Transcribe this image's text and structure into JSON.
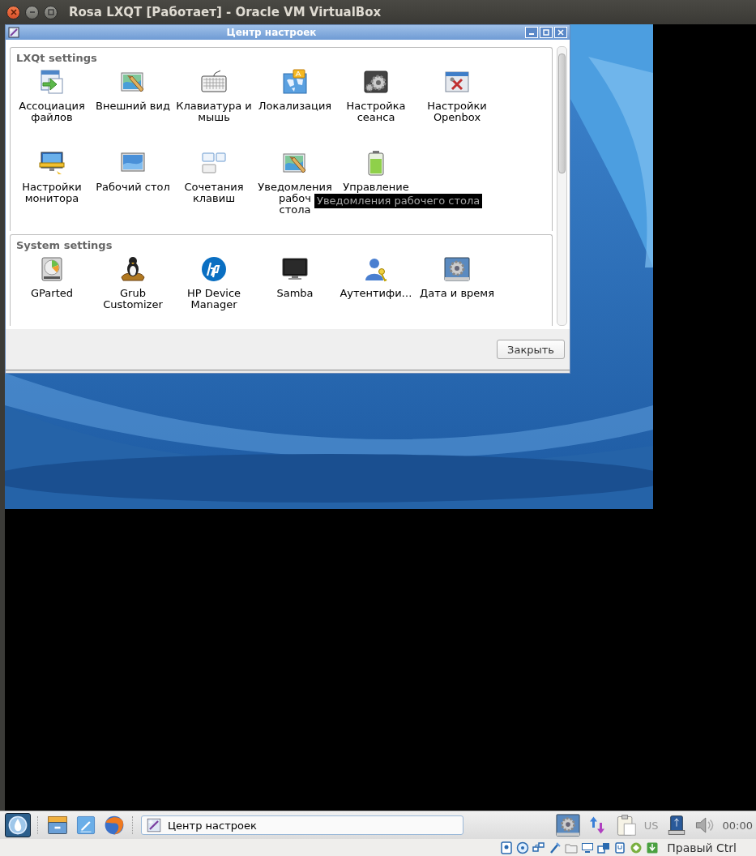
{
  "host_window": {
    "title": "Rosa LXQT [Работает] - Oracle VM VirtualBox"
  },
  "dialog": {
    "title": "Центр настроек",
    "groups": [
      {
        "title": "LXQt settings",
        "items": [
          {
            "label": "Ассоциация\nфайлов"
          },
          {
            "label": "Внешний вид"
          },
          {
            "label": "Клавиатура и\nмышь"
          },
          {
            "label": "Локализация"
          },
          {
            "label": "Настройка\nсеанса"
          },
          {
            "label": "Настройки\nOpenbox"
          },
          {
            "label": "Настройки\nмонитора"
          },
          {
            "label": "Рабочий стол"
          },
          {
            "label": "Сочетания\nклавиш"
          },
          {
            "label": "Уведомления\nрабоч\nстола"
          },
          {
            "label": "Управление"
          }
        ]
      },
      {
        "title": "System settings",
        "items": [
          {
            "label": "GParted"
          },
          {
            "label": "Grub\nCustomizer"
          },
          {
            "label": "HP Device\nManager"
          },
          {
            "label": "Samba"
          },
          {
            "label": "Аутентифи…"
          },
          {
            "label": "Дата и время"
          }
        ]
      }
    ],
    "tooltip": "Уведомления рабочего стола",
    "buttons": [
      "Закрыть"
    ]
  },
  "taskbar": {
    "tasks": [
      {
        "label": "Центр настроек"
      }
    ],
    "keyboard_layout": "US",
    "clock": "00:00"
  },
  "status_bar": {
    "host_key": "Правый Ctrl"
  }
}
